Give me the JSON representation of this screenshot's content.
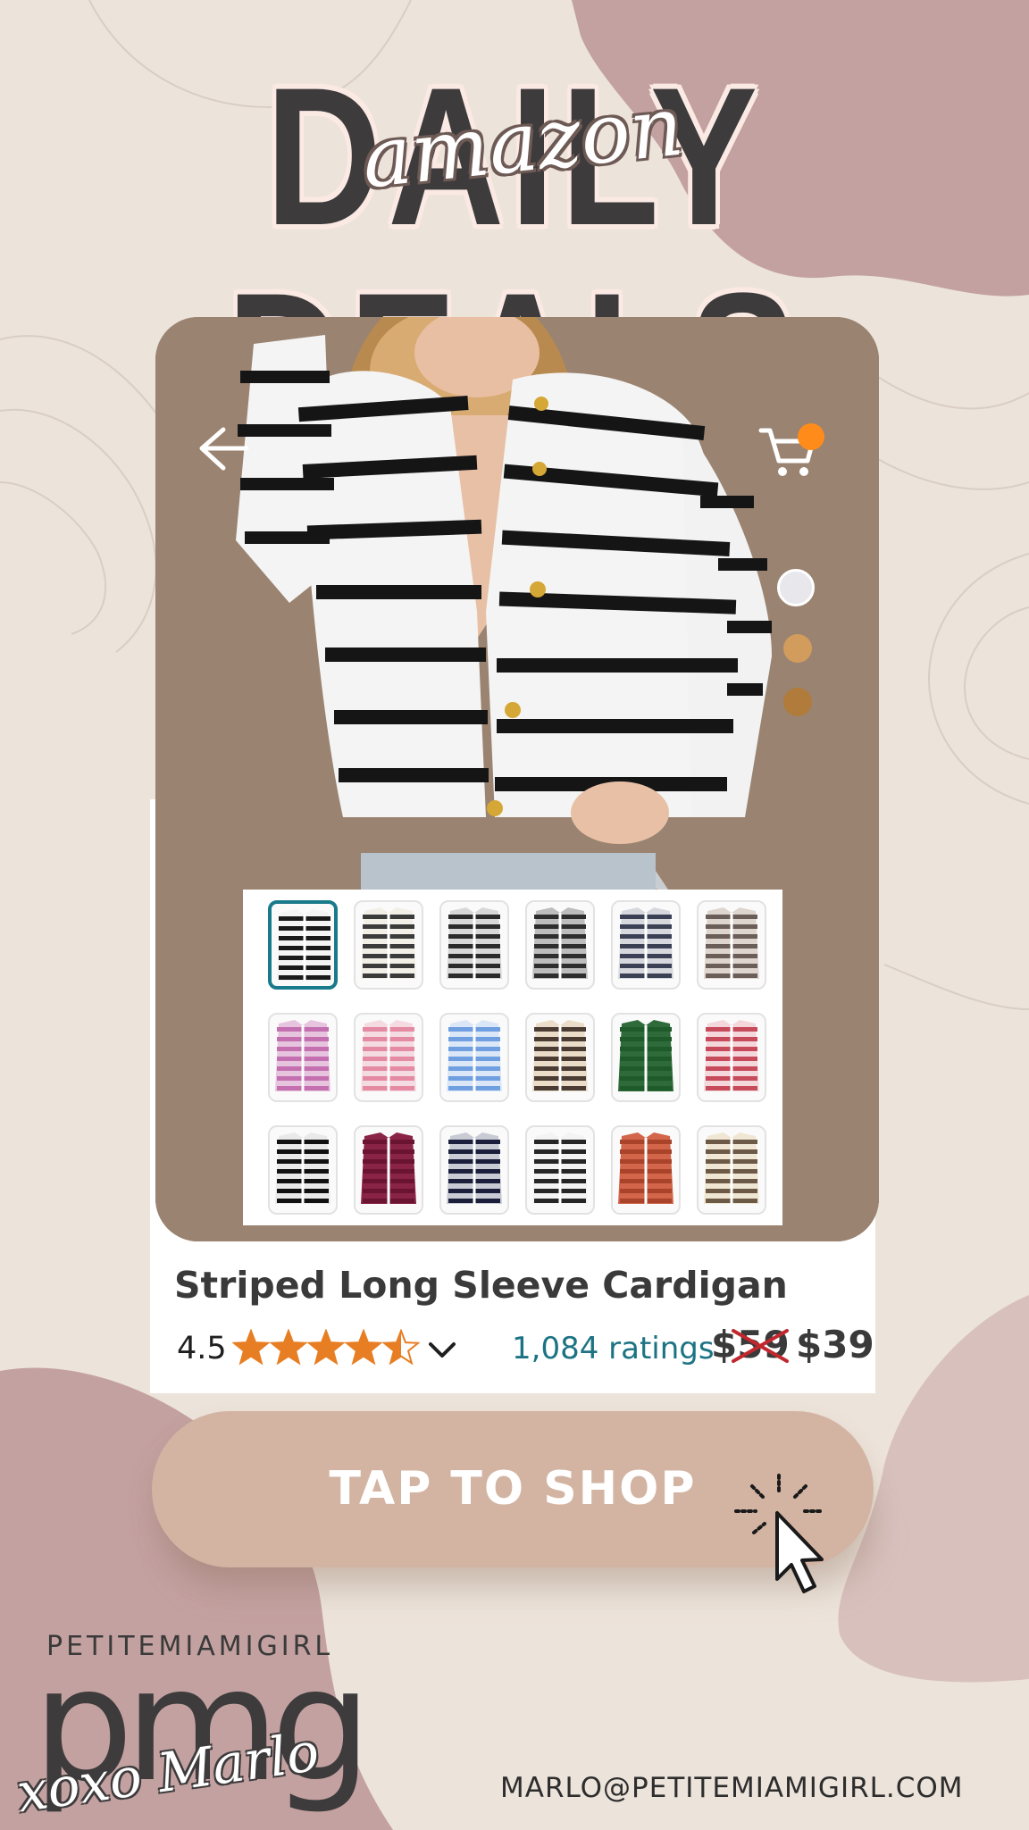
{
  "header": {
    "title": "DAILY DEALS",
    "script": "amazon"
  },
  "product": {
    "title": "Striped Long Sleeve Cardigan",
    "rating": "4.5",
    "rating_stars": 4.5,
    "ratings_count": "1,084 ratings",
    "price_original": "$59",
    "price_sale": "$39",
    "selected_variant": 0,
    "variants": [
      {
        "stripe": "#1a1a1a",
        "base": "#f4f4f4"
      },
      {
        "stripe": "#3b3b3b",
        "base": "#f1efe6"
      },
      {
        "stripe": "#2b2b2b",
        "base": "#d8d8d8"
      },
      {
        "stripe": "#2e2e2e",
        "base": "#bdbdbd"
      },
      {
        "stripe": "#3b4055",
        "base": "#d7d8dd"
      },
      {
        "stripe": "#6b5d57",
        "base": "#ded5cf"
      },
      {
        "stripe": "#c46fb0",
        "base": "#e7c4de"
      },
      {
        "stripe": "#e48aa3",
        "base": "#f4dbe2"
      },
      {
        "stripe": "#6f9fe0",
        "base": "#dbe7f6"
      },
      {
        "stripe": "#4a3b33",
        "base": "#eadcc9"
      },
      {
        "stripe": "#1f5a2a",
        "base": "#2f6b3a"
      },
      {
        "stripe": "#c74a5b",
        "base": "#f3d7da"
      },
      {
        "stripe": "#111111",
        "base": "#e9e9e9"
      },
      {
        "stripe": "#6b1432",
        "base": "#8a2446"
      },
      {
        "stripe": "#1b1f3b",
        "base": "#c9cbd4"
      },
      {
        "stripe": "#262626",
        "base": "#f3f3f3"
      },
      {
        "stripe": "#a9442b",
        "base": "#d2654a"
      },
      {
        "stripe": "#6c5a47",
        "base": "#efe6d3"
      }
    ]
  },
  "swatches": [
    "#e8e8ec",
    "#d29c5d",
    "#b07b3b"
  ],
  "cta": {
    "label": "TAP TO SHOP"
  },
  "footer": {
    "brand": "PETITEMIAMIGIRL",
    "logo": "pmg",
    "signature": "xoxo Marlo",
    "email": "MARLO@PETITEMIAMIGIRL.COM"
  },
  "colors": {
    "background": "#ece3da",
    "mauve": "#c3a1a0",
    "card": "#9a8370",
    "cta": "#d3b4a2",
    "link": "#1c7383",
    "badge": "#ff8c1a"
  }
}
